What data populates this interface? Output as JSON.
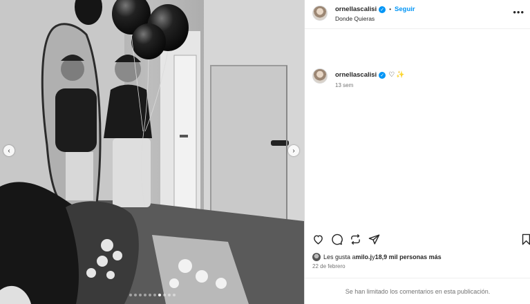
{
  "post": {
    "username": "ornellascalisi",
    "separator": "•",
    "follow_label": "Seguir",
    "location": "Donde Quieras",
    "more_label": "•••",
    "caption_heart": "♡",
    "caption_sparkle": "✨",
    "time_ago": "13 sem",
    "likes_prefix": "Les gusta a ",
    "likes_user": "milo.j",
    "likes_middle": " y ",
    "likes_rest": "18,9 mil personas más",
    "date": "22 de febrero",
    "comments_limited": "Se han limitado los comentarios en esta publicación."
  },
  "carousel": {
    "prev_label": "‹",
    "next_label": "›",
    "dot_count": 10,
    "active_dot_index": 6
  },
  "colors": {
    "accent": "#0095f6",
    "muted": "#737373",
    "border": "#dbdbdb"
  },
  "icons": [
    "heart-icon",
    "comment-icon",
    "share-icon",
    "send-icon",
    "bookmark-icon",
    "verified-icon",
    "more-icon"
  ]
}
